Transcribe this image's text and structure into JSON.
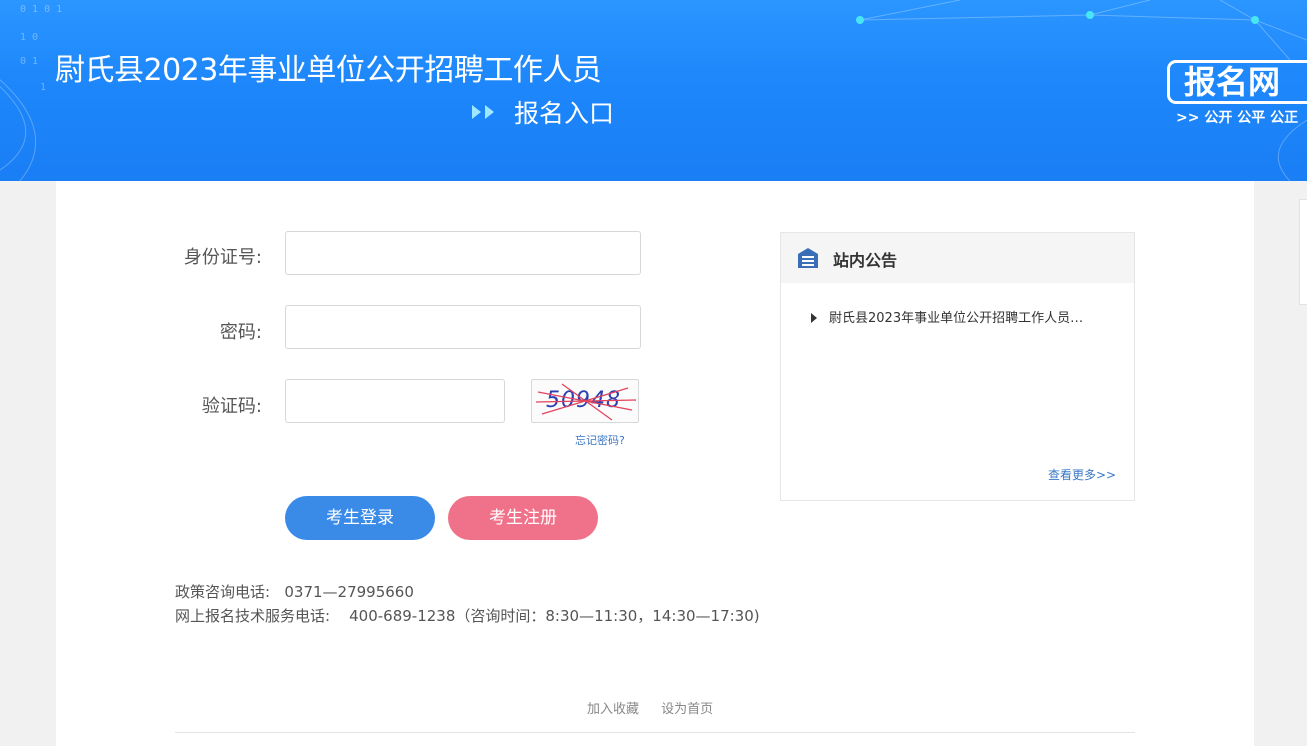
{
  "header": {
    "title": "尉氏县2023年事业单位公开招聘工作人员",
    "entry_label": "报名入口",
    "logo_text": "报名网",
    "logo_tagline": ">> 公开  公平  公正"
  },
  "form": {
    "id_label": "身份证号:",
    "password_label": "密码:",
    "captcha_label": "验证码:",
    "id_value": "",
    "password_value": "",
    "captcha_value": "",
    "captcha_image_text": "50948",
    "forgot_password": "忘记密码?"
  },
  "buttons": {
    "login": "考生登录",
    "register": "考生注册"
  },
  "contact": {
    "policy_line": "政策咨询电话:   0371—27995660",
    "tech_line": "网上报名技术服务电话:    400-689-1238（咨询时间：8:30—11:30，14:30—17:30)"
  },
  "notice": {
    "title": "站内公告",
    "items": [
      "尉氏县2023年事业单位公开招聘工作人员…"
    ],
    "more": "查看更多>>"
  },
  "footer": {
    "favorite": "加入收藏",
    "homepage": "设为首页"
  },
  "colors": {
    "header_blue": "#1d87fb",
    "login_button": "#3a8ae8",
    "register_button": "#f0728a",
    "link_blue": "#3a78c6"
  }
}
